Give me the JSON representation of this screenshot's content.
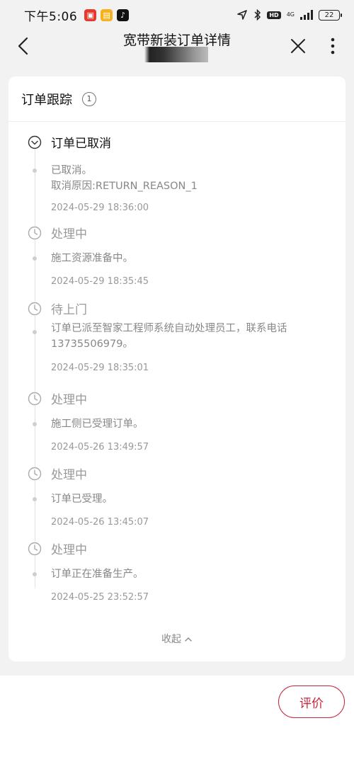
{
  "status_bar": {
    "time": "下午5:06",
    "network": "4G",
    "hd": "HD",
    "battery": "22"
  },
  "nav": {
    "title": "宽带新装订单详情"
  },
  "card": {
    "title": "订单跟踪",
    "info_badge": "1"
  },
  "timeline": [
    {
      "status": "订单已取消",
      "desc": "已取消。",
      "desc2": "取消原因:RETURN_REASON_1",
      "time": "2024-05-29 18:36:00"
    },
    {
      "status": "处理中",
      "desc": "施工资源准备中。",
      "time": "2024-05-29 18:35:45"
    },
    {
      "status": "待上门",
      "desc": "订单已派至智家工程师系统自动处理员工，联系电话13735506979。",
      "time": "2024-05-29 18:35:01"
    },
    {
      "status": "处理中",
      "desc": "施工侧已受理订单。",
      "time": "2024-05-26 13:49:57"
    },
    {
      "status": "处理中",
      "desc": "订单已受理。",
      "time": "2024-05-26 13:45:07"
    },
    {
      "status": "处理中",
      "desc": "订单正在准备生产。",
      "time": "2024-05-25 23:52:57"
    }
  ],
  "collapse_label": "收起",
  "bottom": {
    "rate_label": "评价"
  },
  "colors": {
    "accent": "#c9253a",
    "background": "#f2f2f2"
  }
}
